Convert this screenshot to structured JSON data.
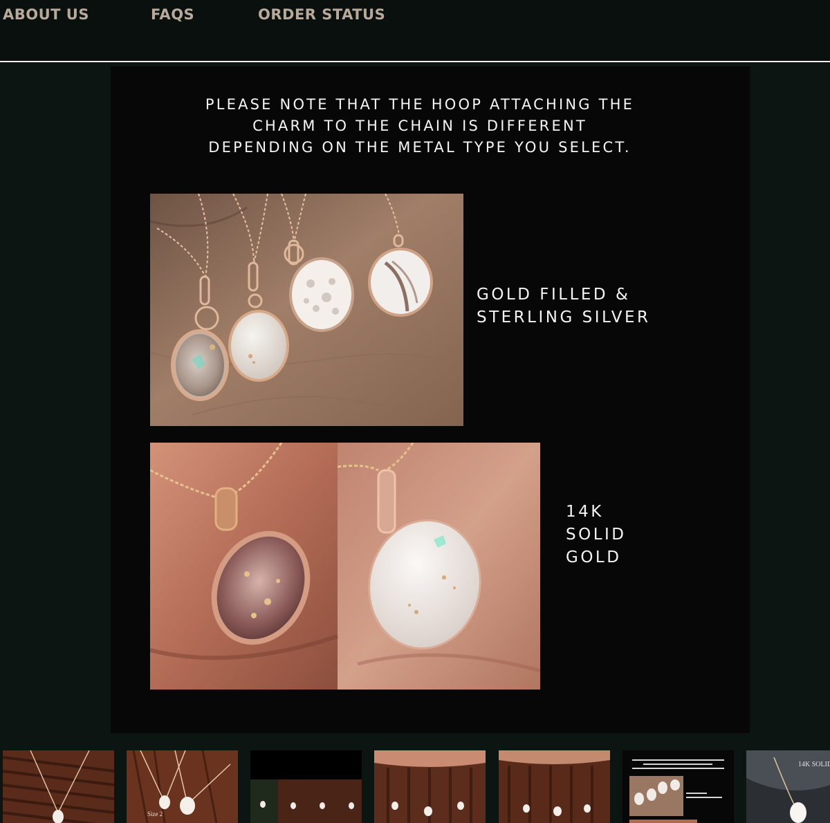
{
  "nav": {
    "items": [
      {
        "label": "ABOUT US"
      },
      {
        "label": "FAQS"
      },
      {
        "label": "ORDER STATUS"
      }
    ]
  },
  "hero": {
    "notice_lines": [
      "PLEASE NOTE THAT THE HOOP ATTACHING THE",
      "CHARM TO THE CHAIN IS DIFFERENT",
      "DEPENDING ON THE METAL TYPE YOU SELECT."
    ],
    "section1": {
      "caption_lines": [
        "GOLD FILLED &",
        "STERLING SILVER"
      ]
    },
    "section2": {
      "caption_lines": [
        "14K",
        "SOLID",
        "GOLD"
      ]
    }
  },
  "thumbnails": [
    {
      "label": ""
    },
    {
      "label": "Size 2"
    },
    {
      "label": ""
    },
    {
      "label": ""
    },
    {
      "label": ""
    },
    {
      "label": ""
    },
    {
      "label": "14K SOLID"
    }
  ],
  "colors": {
    "nav_bg": "#0a100e",
    "nav_text": "#b8a99b",
    "page_bg": "#0d1512",
    "hero_bg": "#070707",
    "text": "#f5f5f5"
  }
}
